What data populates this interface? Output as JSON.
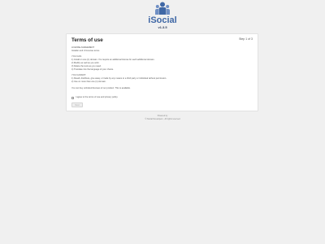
{
  "brand": {
    "name": "iSocial",
    "version": "v1.3.5",
    "logo_icon": "people-icon",
    "color": "#3f67a5"
  },
  "card": {
    "title": "Terms of use",
    "step": "Step 1 of 3",
    "body": [
      "LICENSE AGREEMENT",
      "Installer and UI License terms",
      "",
      "YOU CAN:",
      "1) Install on one (1) domain. You require an additional license for each additional domain.",
      "2) Modify as well as you wish.",
      "3) Delete the texts as you need.",
      "4) Translate into the language of your choice.",
      "",
      "YOU CANNOT:",
      "1) Resell, distribute, give away, or trade by any means to a third party or individual without permission.",
      "2) Use on more than one (1) domain.",
      "",
      "You can buy unlimited licenses of our product. This is available."
    ],
    "agree_label": "I agree to the terms of use and privacy policy.",
    "next_label": "Next"
  },
  "footer": {
    "line1": "Powered by",
    "line2": "© iSocial Developers · All rights reserved"
  }
}
